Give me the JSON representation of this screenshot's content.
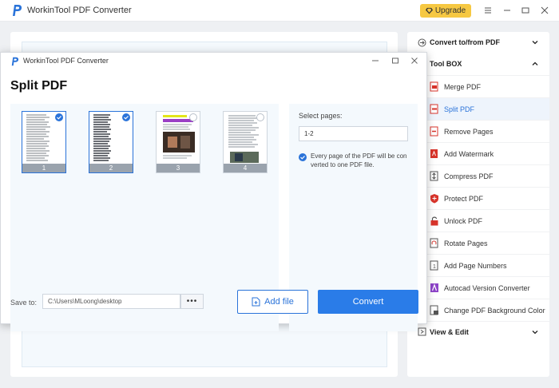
{
  "window": {
    "title": "WorkinTool PDF Converter",
    "upgrade_label": "Upgrade"
  },
  "sidebar": {
    "convert_header": "Convert to/from PDF",
    "toolbox_header": "Tool BOX",
    "view_header": "View & Edit",
    "items": [
      {
        "label": "Merge PDF",
        "icon": "merge-pdf-icon"
      },
      {
        "label": "Split PDF",
        "icon": "split-pdf-icon",
        "active": true
      },
      {
        "label": "Remove Pages",
        "icon": "remove-pages-icon"
      },
      {
        "label": "Add Watermark",
        "icon": "watermark-icon"
      },
      {
        "label": "Compress PDF",
        "icon": "compress-pdf-icon"
      },
      {
        "label": "Protect PDF",
        "icon": "protect-pdf-icon"
      },
      {
        "label": "Unlock PDF",
        "icon": "unlock-pdf-icon"
      },
      {
        "label": "Rotate Pages",
        "icon": "rotate-pages-icon"
      },
      {
        "label": "Add Page Numbers",
        "icon": "page-numbers-icon"
      },
      {
        "label": "Autocad Version Converter",
        "icon": "autocad-icon"
      },
      {
        "label": "Change PDF Background Color",
        "icon": "background-color-icon"
      }
    ]
  },
  "dialog": {
    "title": "WorkinTool PDF Converter",
    "heading": "Split PDF",
    "pages": [
      {
        "number": "1",
        "selected": true
      },
      {
        "number": "2",
        "selected": true
      },
      {
        "number": "3",
        "selected": false
      },
      {
        "number": "4",
        "selected": false
      }
    ],
    "select_pages_label": "Select pages:",
    "pages_value": "1-2",
    "option_text": "Every page of the PDF will be con verted to one PDF file.",
    "save_to_label": "Save to:",
    "save_path": "C:\\Users\\MLoong\\desktop",
    "browse_label": "•••",
    "add_file_label": "Add file",
    "convert_label": "Convert"
  },
  "colors": {
    "accent": "#2a73d9",
    "upgrade": "#f6c842",
    "pdf_red": "#d9342b"
  }
}
